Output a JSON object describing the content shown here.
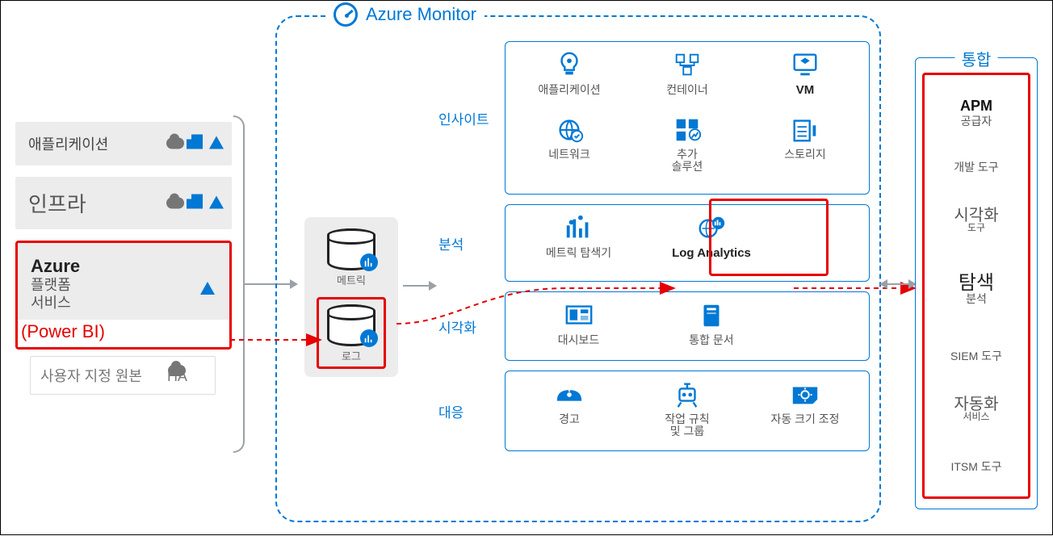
{
  "monitor_title": "Azure Monitor",
  "sources": {
    "app": "애플리케이션",
    "infra": "인프라",
    "azure_title": "Azure",
    "azure_sub1": "플랫폼",
    "azure_sub2": "서비스",
    "powerbi": "(Power BI)",
    "custom": "사용자 지정 원본",
    "custom_suffix": "HA"
  },
  "stores": {
    "metric": "메트릭",
    "log": "로그"
  },
  "sections": {
    "insights": {
      "label": "인사이트",
      "tiles": {
        "app": "애플리케이션",
        "container": "컨테이너",
        "vm": "VM",
        "network": "네트워크",
        "more": "추가\n솔루션",
        "storage": "스토리지"
      }
    },
    "analyze": {
      "label": "분석",
      "tiles": {
        "metric_explorer": "메트릭 탐색기",
        "log_analytics": "Log Analytics"
      }
    },
    "visualize": {
      "label": "시각화",
      "tiles": {
        "dashboard": "대시보드",
        "workbook": "통합 문서"
      }
    },
    "respond": {
      "label": "대응",
      "tiles": {
        "alert": "경고",
        "action": "작업 규칙\n및 그룹",
        "autoscale": "자동 크기 조정"
      }
    }
  },
  "integration": {
    "title": "통합",
    "items": {
      "apm_top": "APM",
      "apm_sub": "공급자",
      "dev": "개발 도구",
      "viz_top": "시각화",
      "viz_sub": "도구",
      "analyze_top": "탐색",
      "analyze_sub": "분석",
      "siem": "SIEM 도구",
      "auto_top": "자동화",
      "auto_sub": "서비스",
      "itsm": "ITSM 도구"
    }
  }
}
